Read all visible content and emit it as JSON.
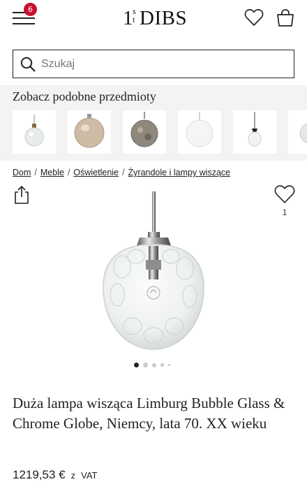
{
  "header": {
    "logo_one": "1",
    "logo_s": "s",
    "logo_t": "t",
    "logo_dibs": "DIBS",
    "cart_badge": "6"
  },
  "search": {
    "placeholder": "Szukaj"
  },
  "similar": {
    "title": "Zobacz podobne przedmioty",
    "items": [
      "ball-pendant-clear",
      "amber-globe-pendant",
      "dark-textured-globe",
      "frosted-globe-pendant",
      "white-opal-pendant",
      "partial-globe-pendant"
    ]
  },
  "breadcrumb": {
    "items": [
      "Dom",
      "Meble",
      "Oświetlenie",
      "Żyrandole i lampy wiszące"
    ],
    "separator": "/"
  },
  "favorite_count": "1",
  "carousel": {
    "active_index": 0,
    "total": 5
  },
  "product": {
    "title": "Duża lampa wisząca Limburg Bubble Glass & Chrome Globe, Niemcy, lata 70. XX wieku",
    "price": "1219,53 €",
    "vat_prefix": "z",
    "vat_label": "VAT"
  },
  "colors": {
    "badge": "#c8102e",
    "strip_bg": "#f3f3f3",
    "text": "#222222"
  }
}
